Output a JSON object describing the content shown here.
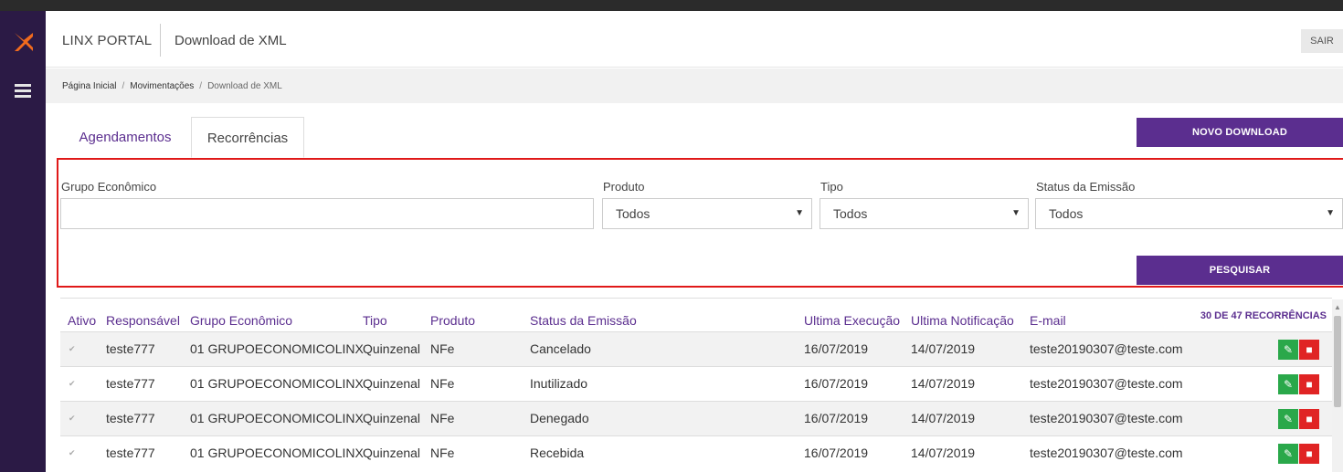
{
  "app": {
    "brand": "LINX PORTAL",
    "title": "Download de XML",
    "logout_label": "SAIR"
  },
  "breadcrumb": {
    "home": "Página Inicial",
    "section": "Movimentações",
    "current": "Download de XML",
    "separator": "/"
  },
  "tabs": [
    {
      "label": "Agendamentos",
      "active": false
    },
    {
      "label": "Recorrências",
      "active": true
    }
  ],
  "actions": {
    "new_download_label": "NOVO DOWNLOAD",
    "search_label": "PESQUISAR"
  },
  "filters": {
    "grupo_economico": {
      "label": "Grupo Econômico",
      "value": ""
    },
    "produto": {
      "label": "Produto",
      "value": "Todos"
    },
    "tipo": {
      "label": "Tipo",
      "value": "Todos"
    },
    "status": {
      "label": "Status da Emissão",
      "value": "Todos"
    }
  },
  "table": {
    "count_label": "30 DE 47 RECORRÊNCIAS",
    "headers": [
      "Ativo",
      "Responsável",
      "Grupo Econômico",
      "Tipo",
      "Produto",
      "Status da Emissão",
      "Ultima Execução",
      "Ultima Notificação",
      "E-mail"
    ],
    "rows": [
      {
        "responsavel": "teste777",
        "grupo": "01 GRUPOECONOMICOLINX",
        "tipo": "Quinzenal",
        "produto": "NFe",
        "status": "Cancelado",
        "ultima_execucao": "16/07/2019",
        "ultima_notificacao": "14/07/2019",
        "email": "teste20190307@teste.com"
      },
      {
        "responsavel": "teste777",
        "grupo": "01 GRUPOECONOMICOLINX",
        "tipo": "Quinzenal",
        "produto": "NFe",
        "status": "Inutilizado",
        "ultima_execucao": "16/07/2019",
        "ultima_notificacao": "14/07/2019",
        "email": "teste20190307@teste.com"
      },
      {
        "responsavel": "teste777",
        "grupo": "01 GRUPOECONOMICOLINX",
        "tipo": "Quinzenal",
        "produto": "NFe",
        "status": "Denegado",
        "ultima_execucao": "16/07/2019",
        "ultima_notificacao": "14/07/2019",
        "email": "teste20190307@teste.com"
      },
      {
        "responsavel": "teste777",
        "grupo": "01 GRUPOECONOMICOLINX",
        "tipo": "Quinzenal",
        "produto": "NFe",
        "status": "Recebida",
        "ultima_execucao": "16/07/2019",
        "ultima_notificacao": "14/07/2019",
        "email": "teste20190307@teste.com"
      }
    ]
  },
  "icons": {
    "logo": "linx-logo-icon",
    "menu": "hamburger-menu-icon",
    "caret": "caret-down-icon",
    "check": "checkmark-icon",
    "edit": "pencil-icon",
    "delete": "trash-icon"
  },
  "colors": {
    "accent": "#5b2e8f",
    "sidebar": "#2b1a45",
    "logo_orange": "#f26b1d",
    "highlight_border": "#e01919",
    "edit_green": "#2aa84a",
    "delete_red": "#e02424"
  }
}
